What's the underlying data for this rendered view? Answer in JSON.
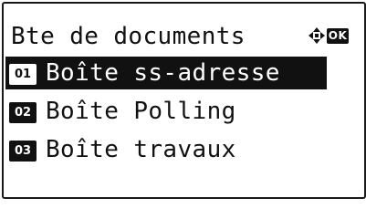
{
  "header": {
    "title": "Bte de documents",
    "nav_icon": "four-way-arrow-icon",
    "ok_label": "OK"
  },
  "menu": {
    "items": [
      {
        "number": "01",
        "label": "Boîte ss-adresse",
        "selected": true
      },
      {
        "number": "02",
        "label": "Boîte Polling",
        "selected": false
      },
      {
        "number": "03",
        "label": "Boîte travaux",
        "selected": false
      }
    ]
  },
  "colors": {
    "foreground": "#111111",
    "background": "#ffffff"
  }
}
